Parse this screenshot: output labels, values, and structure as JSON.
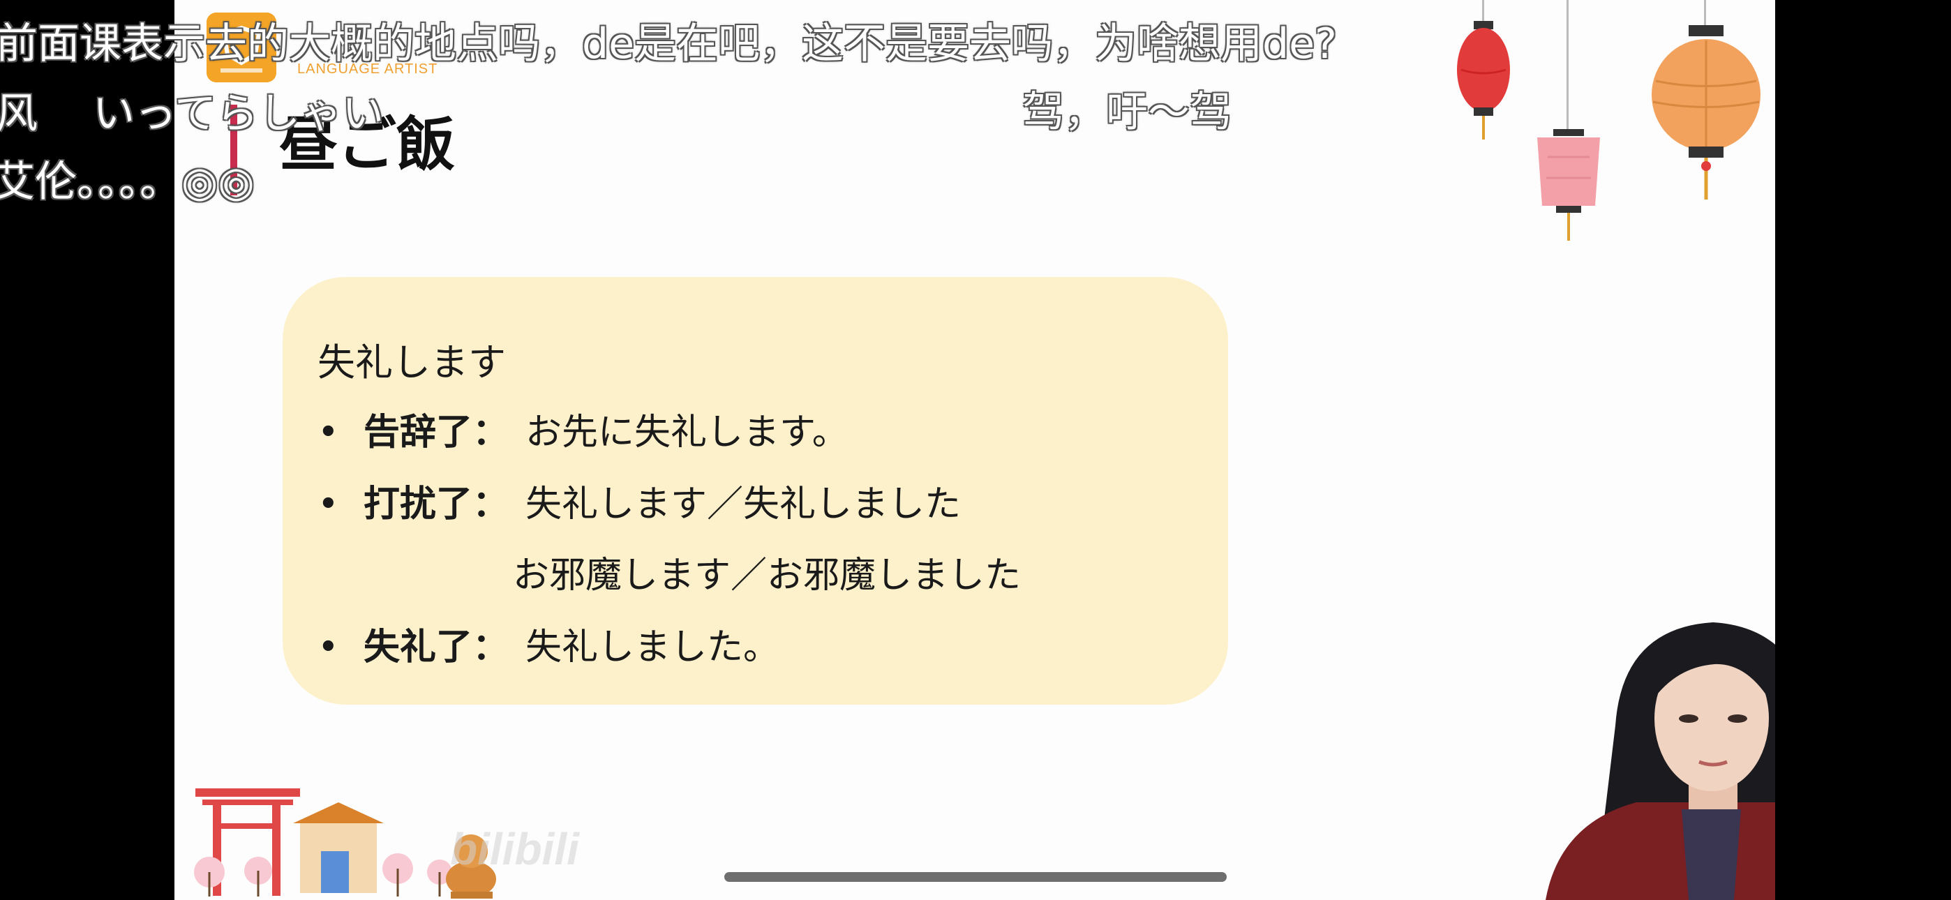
{
  "slide": {
    "logo_text": "LANGUAGE ARTIST",
    "title": "昼ご飯",
    "box": {
      "heading": "失礼します",
      "bullet_symbol": "•",
      "items": [
        {
          "term": "告辞了：",
          "text": "お先に失礼します。"
        },
        {
          "term": "打扰了：",
          "text": "失礼します／失礼しました"
        },
        {
          "term": "",
          "text": "お邪魔します／お邪魔しました"
        },
        {
          "term": "失礼了：",
          "text": "失礼しました。"
        }
      ]
    },
    "watermark": "bilibili"
  },
  "danmaku": [
    "前面课表示去的大概的地点吗，de是在吧，这不是要去吗，为啥想用de?",
    "风　 いってらしゃい",
    "驾，吁～驾",
    "艾伦。。。。◎◎"
  ],
  "colors": {
    "slide_bg": "#fdfdfd",
    "box_bg": "#fdf1cc",
    "title_bar": "#c82d4e",
    "logo": "#f4a426"
  }
}
